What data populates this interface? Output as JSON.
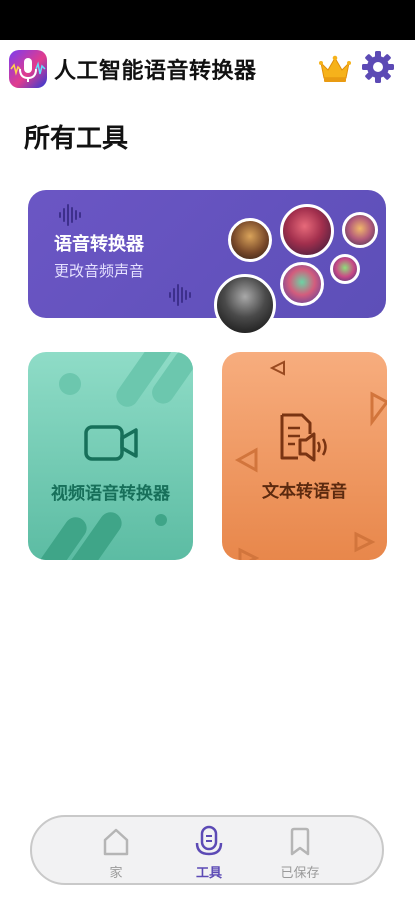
{
  "app": {
    "title": "人工智能语音转换器"
  },
  "page": {
    "section_title": "所有工具"
  },
  "tools": {
    "voice_changer": {
      "title": "语音转换器",
      "subtitle": "更改音频声音"
    },
    "video_voice": {
      "label": "视频语音转换器"
    },
    "text_to_speech": {
      "label": "文本转语音"
    }
  },
  "nav": {
    "items": [
      {
        "label": "家",
        "icon": "home-icon",
        "active": false
      },
      {
        "label": "工具",
        "icon": "microphone-icon",
        "active": true
      },
      {
        "label": "已保存",
        "icon": "bookmark-icon",
        "active": false
      }
    ]
  },
  "colors": {
    "accent": "#5c4ab5",
    "voice_card": "#6252bd",
    "video_card": "#7fd2bd",
    "text_card": "#f39d68"
  }
}
